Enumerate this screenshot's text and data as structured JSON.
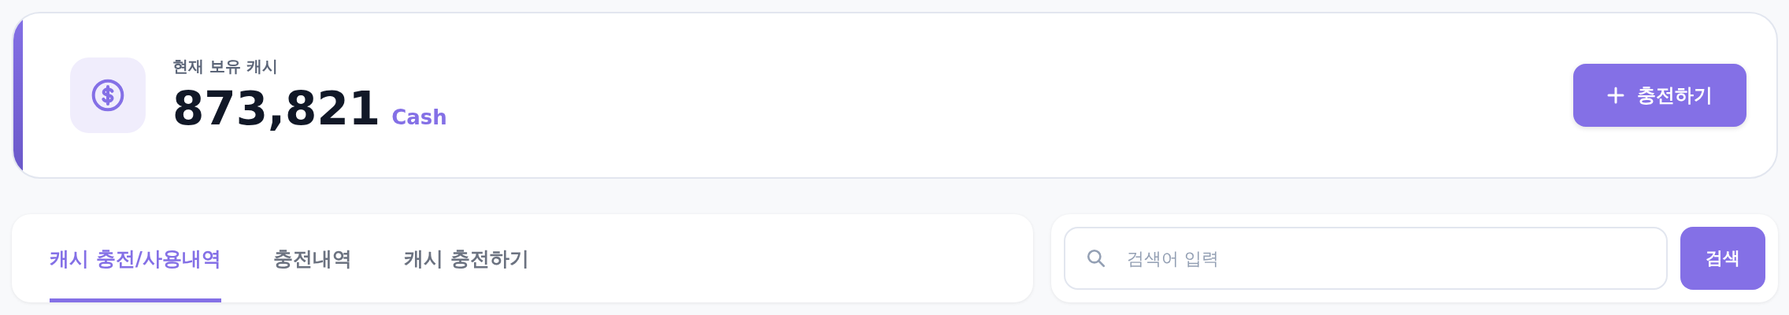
{
  "balance": {
    "label": "현재 보유 캐시",
    "amount": "873,821",
    "unit": "Cash"
  },
  "charge_button": {
    "label": "충전하기"
  },
  "tabs": [
    {
      "label": "캐시 충전/사용내역",
      "selected": true
    },
    {
      "label": "충전내역",
      "selected": false
    },
    {
      "label": "캐시 충전하기",
      "selected": false
    }
  ],
  "search": {
    "placeholder": "검색어 입력",
    "button": "검색"
  }
}
